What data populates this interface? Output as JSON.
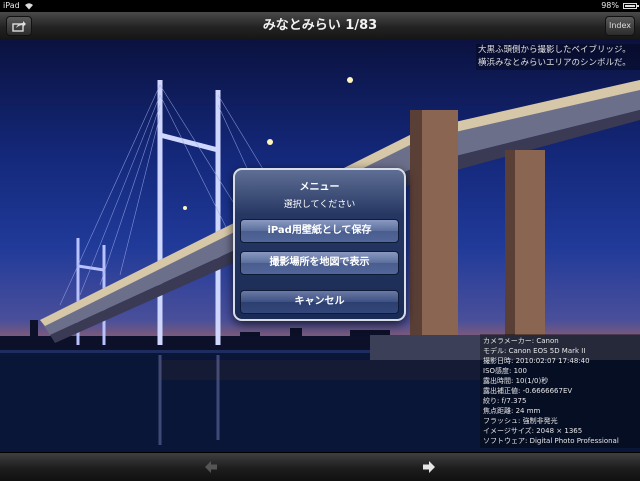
{
  "statusbar": {
    "carrier": "iPad",
    "battery": "98%",
    "battery_level": 0.98
  },
  "navbar": {
    "title": "みなとみらい 1/83",
    "index_label": "Index",
    "share_icon": "share-icon"
  },
  "caption": {
    "text": "大黒ふ頭側から撮影したベイブリッジ。横浜みなとみらいエリアのシンボルだ。"
  },
  "menu": {
    "title": "メニュー",
    "subtitle": "選択してください",
    "buttons": [
      "iPad用壁紙として保存",
      "撮影場所を地図で表示",
      "キャンセル"
    ]
  },
  "exif": [
    "カメラメーカー: Canon",
    "モデル: Canon EOS 5D Mark II",
    "撮影日時: 2010:02:07 17:48:40",
    "ISO感度: 100",
    "露出時間: 10(1/0)秒",
    "露出補正値: -0.6666667EV",
    "絞り: f/7.375",
    "焦点距離: 24 mm",
    "フラッシュ: 強制非発光",
    "イメージサイズ: 2048 × 1365",
    "ソフトウェア: Digital Photo Professional"
  ],
  "toolbar": {
    "prev_icon": "arrow-left-icon",
    "next_icon": "arrow-right-icon"
  },
  "colors": {
    "modal_bg": "#1a2b55",
    "modal_border": "#d8dde8",
    "navbar": "#222222"
  }
}
